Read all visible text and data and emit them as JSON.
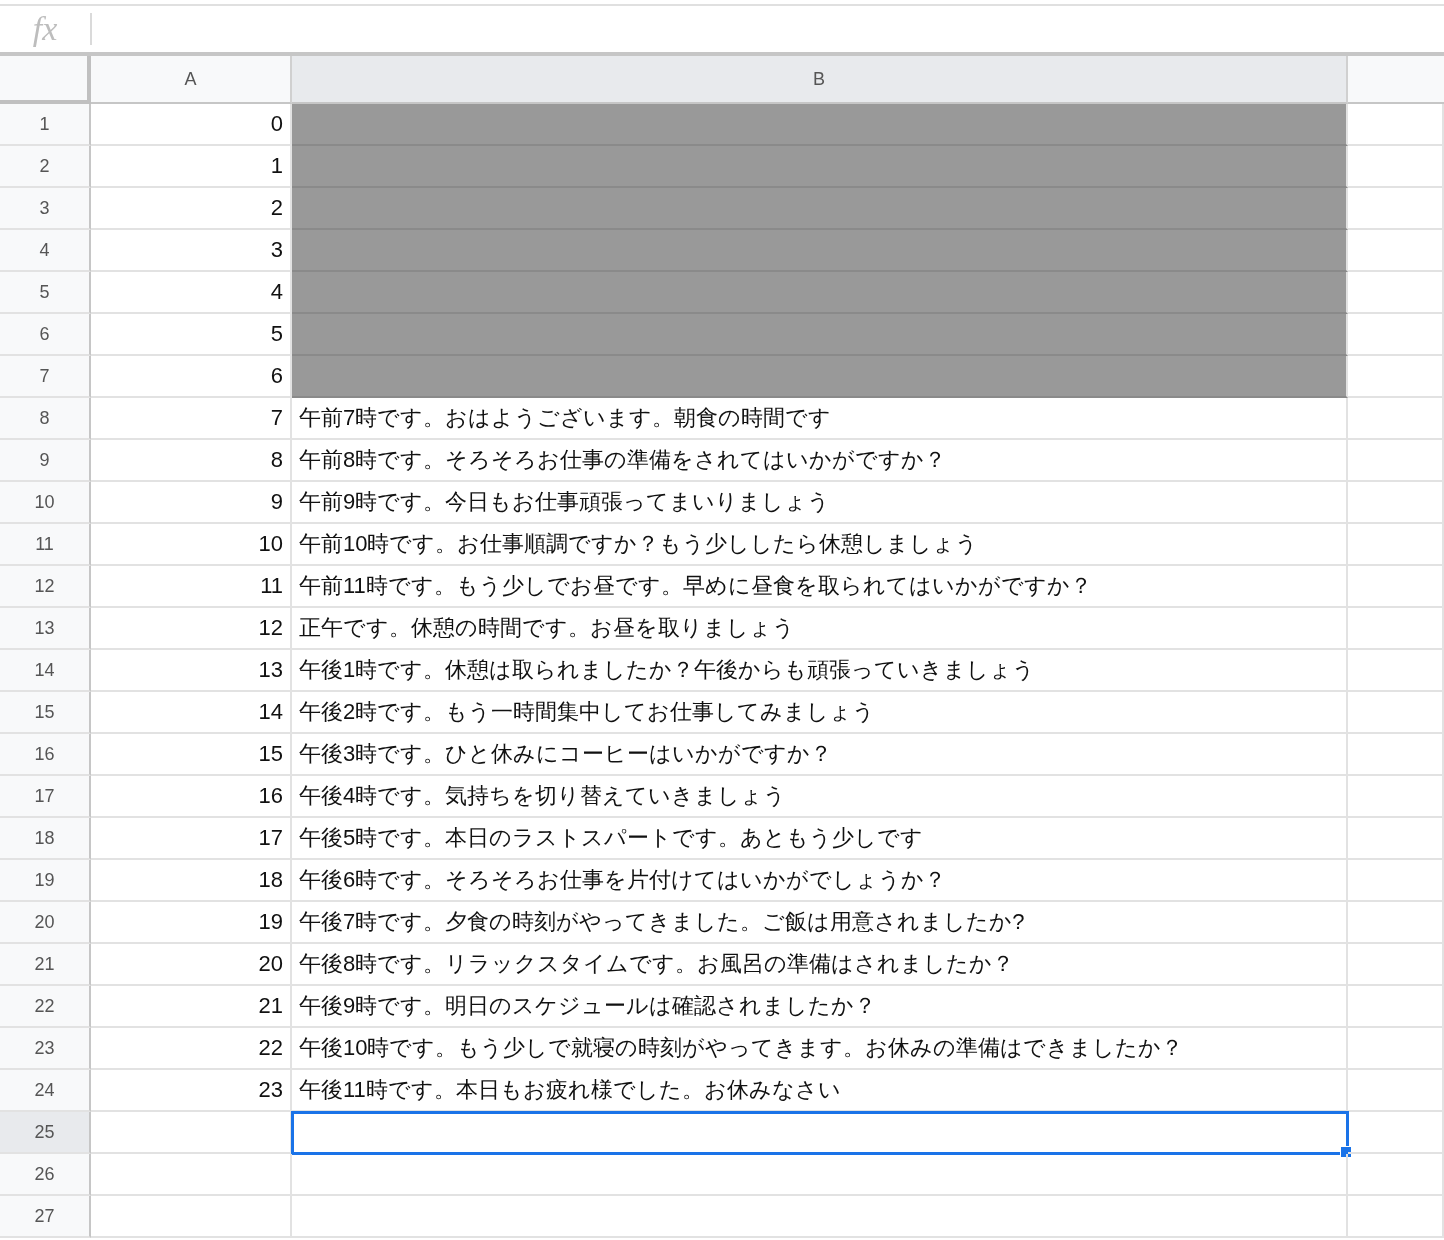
{
  "formula_bar": {
    "icon_label": "fx"
  },
  "columns": [
    {
      "label": "A",
      "selected": false
    },
    {
      "label": "B",
      "selected": true
    }
  ],
  "rows": [
    {
      "number": "1",
      "a": "0",
      "b": "",
      "shaded": true,
      "selected": false
    },
    {
      "number": "2",
      "a": "1",
      "b": "",
      "shaded": true,
      "selected": false
    },
    {
      "number": "3",
      "a": "2",
      "b": "",
      "shaded": true,
      "selected": false
    },
    {
      "number": "4",
      "a": "3",
      "b": "",
      "shaded": true,
      "selected": false
    },
    {
      "number": "5",
      "a": "4",
      "b": "",
      "shaded": true,
      "selected": false
    },
    {
      "number": "6",
      "a": "5",
      "b": "",
      "shaded": true,
      "selected": false
    },
    {
      "number": "7",
      "a": "6",
      "b": "",
      "shaded": true,
      "selected": false
    },
    {
      "number": "8",
      "a": "7",
      "b": "午前7時です。おはようございます。朝食の時間です",
      "shaded": false,
      "selected": false
    },
    {
      "number": "9",
      "a": "8",
      "b": "午前8時です。そろそろお仕事の準備をされてはいかがですか？",
      "shaded": false,
      "selected": false
    },
    {
      "number": "10",
      "a": "9",
      "b": "午前9時です。今日もお仕事頑張ってまいりましょう",
      "shaded": false,
      "selected": false
    },
    {
      "number": "11",
      "a": "10",
      "b": "午前10時です。お仕事順調ですか？もう少ししたら休憩しましょう",
      "shaded": false,
      "selected": false
    },
    {
      "number": "12",
      "a": "11",
      "b": "午前11時です。もう少しでお昼です。早めに昼食を取られてはいかがですか？",
      "shaded": false,
      "selected": false
    },
    {
      "number": "13",
      "a": "12",
      "b": "正午です。休憩の時間です。お昼を取りましょう",
      "shaded": false,
      "selected": false
    },
    {
      "number": "14",
      "a": "13",
      "b": "午後1時です。休憩は取られましたか？午後からも頑張っていきましょう",
      "shaded": false,
      "selected": false
    },
    {
      "number": "15",
      "a": "14",
      "b": "午後2時です。もう一時間集中してお仕事してみましょう",
      "shaded": false,
      "selected": false
    },
    {
      "number": "16",
      "a": "15",
      "b": "午後3時です。ひと休みにコーヒーはいかがですか？",
      "shaded": false,
      "selected": false
    },
    {
      "number": "17",
      "a": "16",
      "b": "午後4時です。気持ちを切り替えていきましょう",
      "shaded": false,
      "selected": false
    },
    {
      "number": "18",
      "a": "17",
      "b": "午後5時です。本日のラストスパートです。あともう少しです",
      "shaded": false,
      "selected": false
    },
    {
      "number": "19",
      "a": "18",
      "b": "午後6時です。そろそろお仕事を片付けてはいかがでしょうか？",
      "shaded": false,
      "selected": false
    },
    {
      "number": "20",
      "a": "19",
      "b": "午後7時です。夕食の時刻がやってきました。ご飯は用意されましたか?",
      "shaded": false,
      "selected": false
    },
    {
      "number": "21",
      "a": "20",
      "b": "午後8時です。リラックスタイムです。お風呂の準備はされましたか？",
      "shaded": false,
      "selected": false
    },
    {
      "number": "22",
      "a": "21",
      "b": "午後9時です。明日のスケジュールは確認されましたか？",
      "shaded": false,
      "selected": false
    },
    {
      "number": "23",
      "a": "22",
      "b": "午後10時です。もう少しで就寝の時刻がやってきます。お休みの準備はできましたか？",
      "shaded": false,
      "selected": false
    },
    {
      "number": "24",
      "a": "23",
      "b": "午後11時です。本日もお疲れ様でした。お休みなさい",
      "shaded": false,
      "selected": false
    },
    {
      "number": "25",
      "a": "",
      "b": "",
      "shaded": false,
      "selected": true
    },
    {
      "number": "26",
      "a": "",
      "b": "",
      "shaded": false,
      "selected": false
    },
    {
      "number": "27",
      "a": "",
      "b": "",
      "shaded": false,
      "selected": false
    }
  ]
}
